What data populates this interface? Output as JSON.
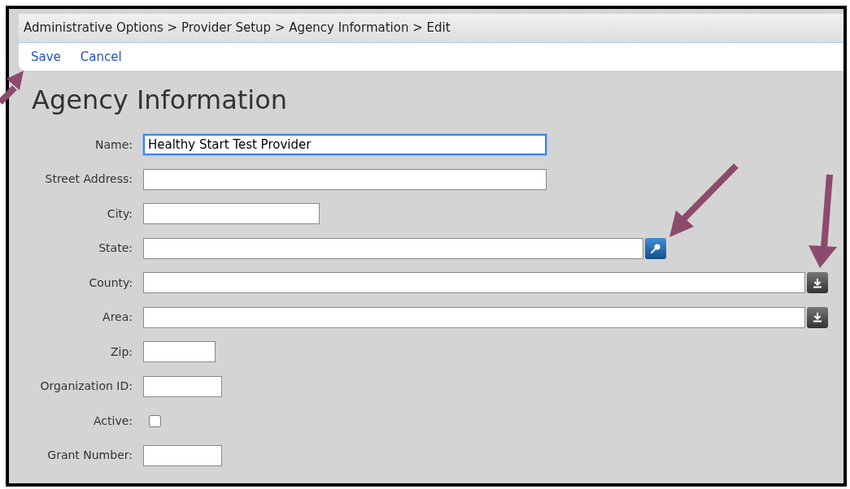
{
  "breadcrumb": "Administrative Options > Provider Setup > Agency Information > Edit",
  "toolbar": [
    "Save",
    "Cancel"
  ],
  "title": "Agency Information",
  "fields": [
    {
      "label": "Name:",
      "kind": "text",
      "value": "Healthy Start Test Provider",
      "focused": true
    },
    {
      "label": "Street Address:",
      "kind": "text",
      "focused": false
    },
    {
      "label": "City:",
      "kind": "text",
      "focused": false
    },
    {
      "label": "State:",
      "kind": "lookup",
      "focused": false
    },
    {
      "label": "County:",
      "kind": "dropdown",
      "focused": false
    },
    {
      "label": "Area:",
      "kind": "dropdown",
      "focused": false
    },
    {
      "label": "Zip:",
      "kind": "text",
      "focused": false
    },
    {
      "label": "Organization ID:",
      "kind": "text",
      "focused": false
    },
    {
      "label": "Active:",
      "kind": "checkbox",
      "checked": false
    },
    {
      "label": "Grant Number:",
      "kind": "text",
      "focused": false
    }
  ]
}
